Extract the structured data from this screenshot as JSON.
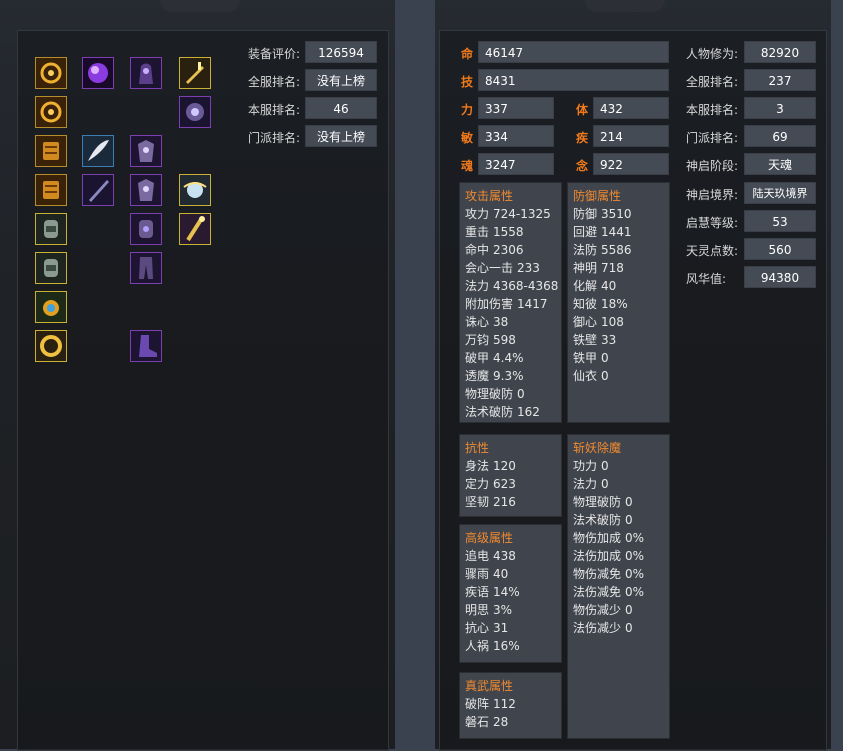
{
  "equipment": {
    "slots": [
      {
        "icon": "gear-ring-icon"
      },
      {
        "icon": "purple-orb-icon"
      },
      {
        "icon": "hooded-armor-icon"
      },
      {
        "icon": "golden-sword-icon"
      },
      {
        "icon": "gear-ring-icon"
      },
      {
        "icon": "dark-gauntlet-icon"
      },
      {
        "icon": "scroll-icon"
      },
      {
        "icon": "feather-wing-icon"
      },
      {
        "icon": "armor-chest-icon"
      },
      {
        "icon": "scroll-icon"
      },
      {
        "icon": "blade-icon"
      },
      {
        "icon": "armor-chest-icon"
      },
      {
        "icon": "orb-wing-icon"
      },
      {
        "icon": "bracer-icon"
      },
      {
        "icon": "bracer-purple-icon"
      },
      {
        "icon": "golden-staff-icon"
      },
      {
        "icon": "bracer-icon"
      },
      {
        "icon": "leg-armor-icon"
      },
      {
        "icon": "amulet-icon"
      },
      {
        "icon": "ring-gold-icon"
      },
      {
        "icon": "boots-icon"
      }
    ]
  },
  "left_stats": [
    {
      "label": "装备评价:",
      "value": "126594"
    },
    {
      "label": "全服排名:",
      "value": "没有上榜"
    },
    {
      "label": "本服排名:",
      "value": "46"
    },
    {
      "label": "门派排名:",
      "value": "没有上榜"
    }
  ],
  "core": {
    "ming": {
      "label": "命",
      "value": "46147"
    },
    "ji": {
      "label": "技",
      "value": "8431"
    },
    "li": {
      "label": "力",
      "value": "337"
    },
    "ti": {
      "label": "体",
      "value": "432"
    },
    "min": {
      "label": "敏",
      "value": "334"
    },
    "ji2": {
      "label": "疾",
      "value": "214"
    },
    "hun": {
      "label": "魂",
      "value": "3247"
    },
    "nian": {
      "label": "念",
      "value": "922"
    }
  },
  "right_stats": [
    {
      "label": "人物修为:",
      "value": "82920"
    },
    {
      "label": "全服排名:",
      "value": "237"
    },
    {
      "label": "本服排名:",
      "value": "3"
    },
    {
      "label": "门派排名:",
      "value": "69"
    },
    {
      "label": "神启阶段:",
      "value": "天魂"
    },
    {
      "label": "神启境界:",
      "value": "陆天玖境界"
    },
    {
      "label": "启慧等级:",
      "value": "53"
    },
    {
      "label": "天灵点数:",
      "value": "560"
    },
    {
      "label": "风华值:",
      "value": "94380"
    }
  ],
  "attack": {
    "title": "攻击属性",
    "rows": [
      {
        "k": "攻力",
        "v": "724-1325"
      },
      {
        "k": "重击",
        "v": "1558"
      },
      {
        "k": "命中",
        "v": "2306"
      },
      {
        "k": "会心一击",
        "v": "233"
      },
      {
        "k": "法力",
        "v": "4368-4368"
      },
      {
        "k": "附加伤害",
        "v": "1417"
      },
      {
        "k": "诛心",
        "v": "38"
      },
      {
        "k": "万钧",
        "v": "598"
      },
      {
        "k": "破甲",
        "v": "4.4%"
      },
      {
        "k": "透魔",
        "v": "9.3%"
      },
      {
        "k": "物理破防",
        "v": "0"
      },
      {
        "k": "法术破防",
        "v": "162"
      }
    ]
  },
  "defense": {
    "title": "防御属性",
    "rows": [
      {
        "k": "防御",
        "v": "3510"
      },
      {
        "k": "回避",
        "v": "1441"
      },
      {
        "k": "法防",
        "v": "5586"
      },
      {
        "k": "神明",
        "v": "718"
      },
      {
        "k": "化解",
        "v": "40"
      },
      {
        "k": "知彼",
        "v": "18%"
      },
      {
        "k": "御心",
        "v": "108"
      },
      {
        "k": "铁壁",
        "v": "33"
      },
      {
        "k": "铁甲",
        "v": "0"
      },
      {
        "k": "仙衣",
        "v": "0"
      }
    ]
  },
  "resist": {
    "title": "抗性",
    "rows": [
      {
        "k": "身法",
        "v": "120"
      },
      {
        "k": "定力",
        "v": "623"
      },
      {
        "k": "坚韧",
        "v": "216"
      }
    ]
  },
  "advanced": {
    "title": "高级属性",
    "rows": [
      {
        "k": "追电",
        "v": "438"
      },
      {
        "k": "骤雨",
        "v": "40"
      },
      {
        "k": "疾语",
        "v": "14%"
      },
      {
        "k": "明思",
        "v": "3%"
      },
      {
        "k": "抗心",
        "v": "31"
      },
      {
        "k": "人祸",
        "v": "16%"
      }
    ]
  },
  "xinyao": {
    "title": "斩妖除魔",
    "rows": [
      {
        "k": "功力",
        "v": "0"
      },
      {
        "k": "法力",
        "v": "0"
      },
      {
        "k": "物理破防",
        "v": "0"
      },
      {
        "k": "法术破防",
        "v": "0"
      },
      {
        "k": "物伤加成",
        "v": "0%"
      },
      {
        "k": "法伤加成",
        "v": "0%"
      },
      {
        "k": "物伤减免",
        "v": "0%"
      },
      {
        "k": "法伤减免",
        "v": "0%"
      },
      {
        "k": "物伤减少",
        "v": "0"
      },
      {
        "k": "法伤减少",
        "v": "0"
      }
    ]
  },
  "zhenwu": {
    "title": "真武属性",
    "rows": [
      {
        "k": "破阵",
        "v": "112"
      },
      {
        "k": "磐石",
        "v": "28"
      }
    ]
  },
  "colors": {
    "accent": "#f07a1b",
    "value_bg": "#444b55",
    "box_bg": "#40454d"
  }
}
